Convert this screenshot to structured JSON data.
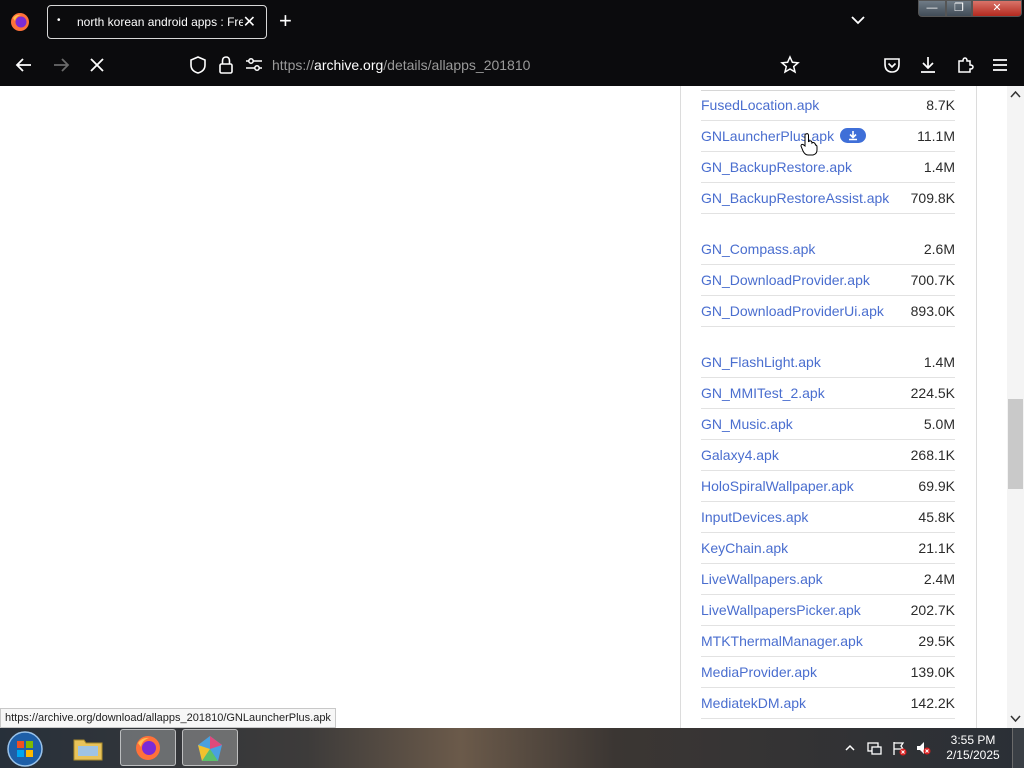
{
  "browser": {
    "tab_title": "north korean android apps : Fre",
    "tab_dot": "•",
    "tab_close": "✕",
    "new_tab": "+",
    "url_prefix": "https://",
    "url_domain": "archive.org",
    "url_path": "/details/allapps_201810",
    "status_url": "https://archive.org/download/allapps_201810/GNLauncherPlus.apk"
  },
  "window_controls": {
    "minimize": "—",
    "maximize": "❐",
    "close": "✕"
  },
  "files": [
    {
      "name": "FusedLocation.apk",
      "size": "8.7K"
    },
    {
      "name": "GNLauncherPlus.apk",
      "size": "11.1M",
      "hovered": true
    },
    {
      "name": "GN_BackupRestore.apk",
      "size": "1.4M"
    },
    {
      "name": "GN_BackupRestoreAssist.apk",
      "size": "709.8K"
    },
    {
      "name": "GN_Compass.apk",
      "size": "2.6M"
    },
    {
      "name": "GN_DownloadProvider.apk",
      "size": "700.7K"
    },
    {
      "name": "GN_DownloadProviderUi.apk",
      "size": "893.0K"
    },
    {
      "name": "GN_FlashLight.apk",
      "size": "1.4M"
    },
    {
      "name": "GN_MMITest_2.apk",
      "size": "224.5K"
    },
    {
      "name": "GN_Music.apk",
      "size": "5.0M"
    },
    {
      "name": "Galaxy4.apk",
      "size": "268.1K"
    },
    {
      "name": "HoloSpiralWallpaper.apk",
      "size": "69.9K"
    },
    {
      "name": "InputDevices.apk",
      "size": "45.8K"
    },
    {
      "name": "KeyChain.apk",
      "size": "21.1K"
    },
    {
      "name": "LiveWallpapers.apk",
      "size": "2.4M"
    },
    {
      "name": "LiveWallpapersPicker.apk",
      "size": "202.7K"
    },
    {
      "name": "MTKThermalManager.apk",
      "size": "29.5K"
    },
    {
      "name": "MediaProvider.apk",
      "size": "139.0K"
    },
    {
      "name": "MediatekDM.apk",
      "size": "142.2K"
    }
  ],
  "taskbar": {
    "time": "3:55 PM",
    "date": "2/15/2025"
  },
  "colors": {
    "link": "#4a6ecf",
    "browser_chrome": "#0b0b0d",
    "badge": "#3f6fd8"
  }
}
